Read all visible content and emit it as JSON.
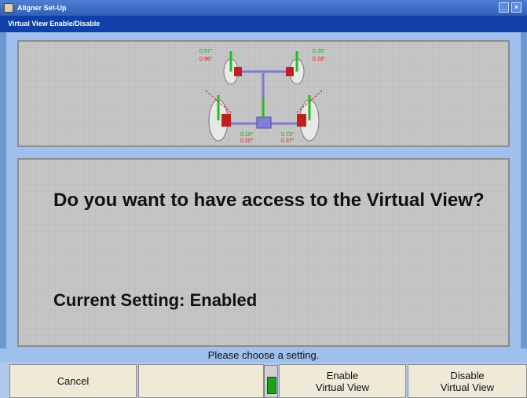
{
  "window": {
    "title": "Aligner Set-Up",
    "subtitle": "Virtual View Enable/Disable"
  },
  "diagram": {
    "readings": [
      "0.97°",
      "0.96°",
      "0.35°",
      "0.18°",
      "0.19°",
      "0.20°",
      "0.73°",
      "0.37°"
    ],
    "colors": {
      "green": "#21c021",
      "red": "#e01818",
      "chassis": "#7a7ad0",
      "tire": "#e8e8e8"
    }
  },
  "message": {
    "question": "Do you want to have access to the Virtual View?",
    "current_setting_label": "Current Setting:",
    "current_setting_value": "Enabled"
  },
  "status": "Please choose a setting.",
  "buttons": {
    "cancel": "Cancel",
    "blank": "",
    "enable_line1": "Enable",
    "enable_line2": "Virtual View",
    "disable_line1": "Disable",
    "disable_line2": "Virtual View"
  },
  "indicator": {
    "state": "green"
  }
}
